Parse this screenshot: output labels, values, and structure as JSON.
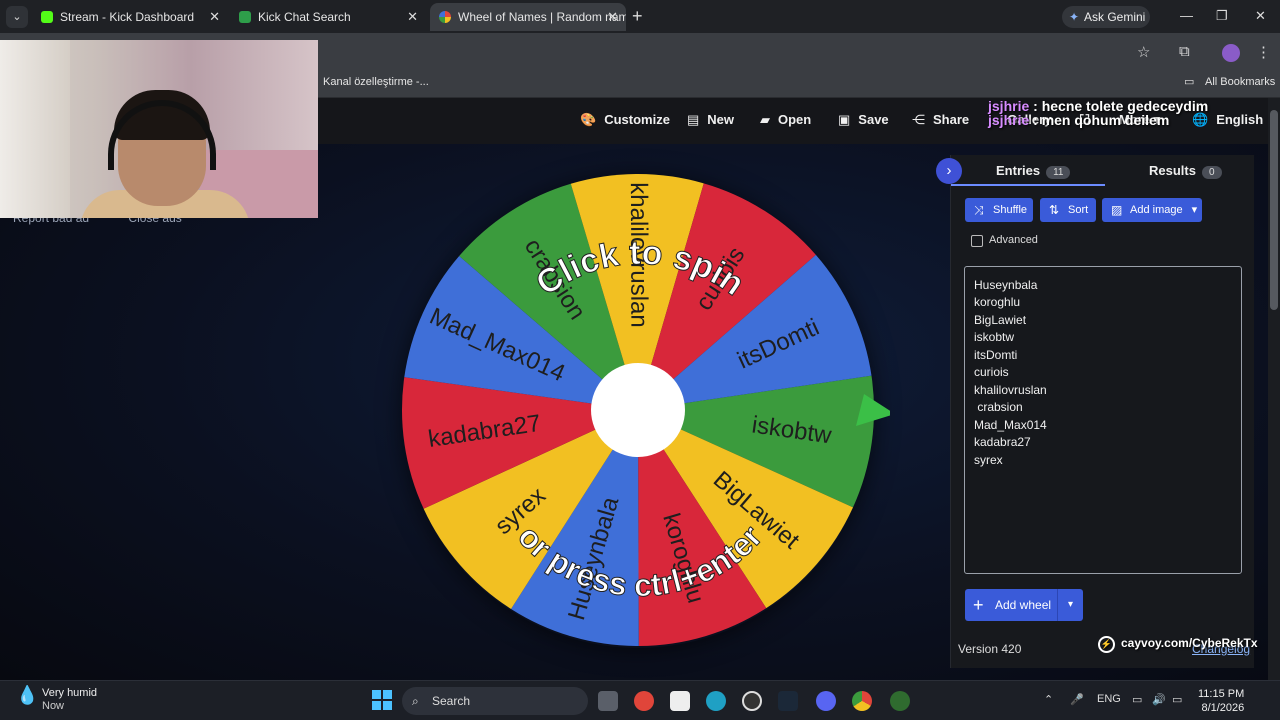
{
  "browser": {
    "tabs": [
      {
        "label": "Stream - Kick Dashboard",
        "favicon_color": "#53fc18"
      },
      {
        "label": "Kick Chat Search",
        "favicon_color": "#2e9e4a"
      },
      {
        "label": "Wheel of Names | Random nam",
        "favicon_color": "#e0453a"
      }
    ],
    "ask_gemini": "Ask Gemini",
    "bookmark_item": "Kanal özelleştirme -...",
    "all_bookmarks": "All Bookmarks"
  },
  "toolbar": {
    "customize": "Customize",
    "new": "New",
    "open": "Open",
    "save": "Save",
    "share": "Share",
    "gallery": "Gallery",
    "more": "More",
    "language": "English"
  },
  "chat_overlay": [
    {
      "user": "jsjhrie",
      "message": " : hecne tolete gedeceydim"
    },
    {
      "user": "jsjhrie",
      "message": " : men qohum deilem"
    }
  ],
  "ads_bar": {
    "report": "Report bad ad",
    "close": "Close ads"
  },
  "wheel": {
    "prompt_top": "Click to spin",
    "prompt_bottom": "or press ctrl+enter",
    "segments": [
      {
        "name": "iskobtw",
        "color": "#3b9b3d"
      },
      {
        "name": "BigLawiet",
        "color": "#f2c022"
      },
      {
        "name": "koroghlu",
        "color": "#d8273a"
      },
      {
        "name": "Huseynbala",
        "color": "#3f6fd8"
      },
      {
        "name": "syrex",
        "color": "#f2c022"
      },
      {
        "name": "kadabra27",
        "color": "#d8273a"
      },
      {
        "name": "Mad_Max014",
        "color": "#3f6fd8"
      },
      {
        "name": "crabsion",
        "color": "#3b9b3d"
      },
      {
        "name": "khalilovruslan",
        "color": "#f2c022"
      },
      {
        "name": "curiois",
        "color": "#d8273a"
      },
      {
        "name": "itsDomti",
        "color": "#3f6fd8"
      }
    ],
    "pointer_color": "#3bbf47"
  },
  "panel": {
    "entries_tab": "Entries",
    "entries_count": "11",
    "results_tab": "Results",
    "results_count": "0",
    "shuffle": "Shuffle",
    "sort": "Sort",
    "add_image": "Add image",
    "advanced": "Advanced",
    "entries": [
      "Huseynbala",
      "koroghlu",
      "BigLawiet",
      "iskobtw",
      "itsDomti",
      "curiois",
      "khalilovruslan",
      " crabsion",
      "Mad_Max014",
      "kadabra27",
      "syrex"
    ],
    "add_wheel": "Add wheel",
    "version": "Version 420",
    "changelog": "Changelog"
  },
  "stream_overlay_link": "cayvoy.com/CybeRekTx",
  "taskbar": {
    "weather_title": "Very humid",
    "weather_sub": "Now",
    "search": "Search",
    "lang": "ENG",
    "time": "11:15 PM",
    "date": "8/1/2026"
  }
}
